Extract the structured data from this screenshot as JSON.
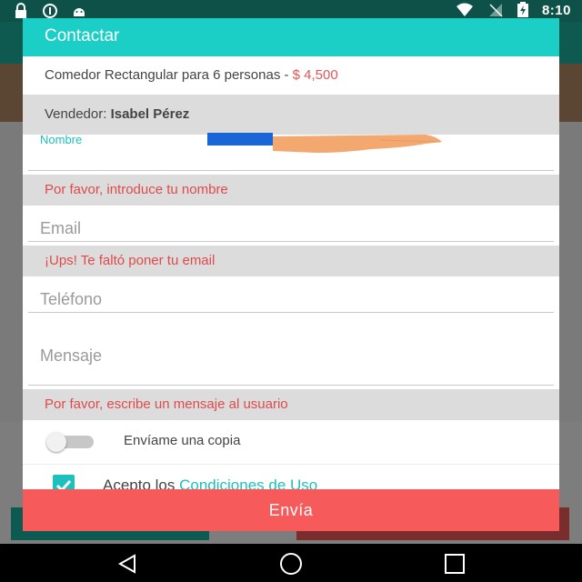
{
  "status_bar": {
    "time": "8:10",
    "left_icons": [
      "lock-icon",
      "info-circle-icon",
      "android-icon"
    ],
    "right_icons": [
      "wifi-icon",
      "signal-icon",
      "battery-charging-icon"
    ]
  },
  "dialog": {
    "title": "Contactar",
    "product": {
      "name": "Comedor Rectangular para 6 personas - ",
      "price": "$ 4,500"
    },
    "seller": {
      "label": "Vendedor: ",
      "name": "Isabel Pérez"
    },
    "fields": {
      "name": {
        "label": "Nombre",
        "value": "",
        "error": "Por favor, introduce tu nombre"
      },
      "email": {
        "placeholder": "Email",
        "error": "¡Ups! Te faltó poner tu email"
      },
      "phone": {
        "placeholder": "Teléfono"
      },
      "message": {
        "placeholder": "Mensaje",
        "error": "Por favor, escribe un mensaje al usuario"
      }
    },
    "send_copy": {
      "label": "Envíame una copia",
      "checked": false
    },
    "terms": {
      "prefix": "Acepto los ",
      "link": "Condiciones de Uso",
      "checked": true
    },
    "send_button": "Envía"
  },
  "colors": {
    "accent": "#1ccfc6",
    "error": "#e04a4a",
    "send_button": "#f65a5a"
  },
  "nav_bar": [
    "back-icon",
    "home-icon",
    "recents-icon"
  ]
}
